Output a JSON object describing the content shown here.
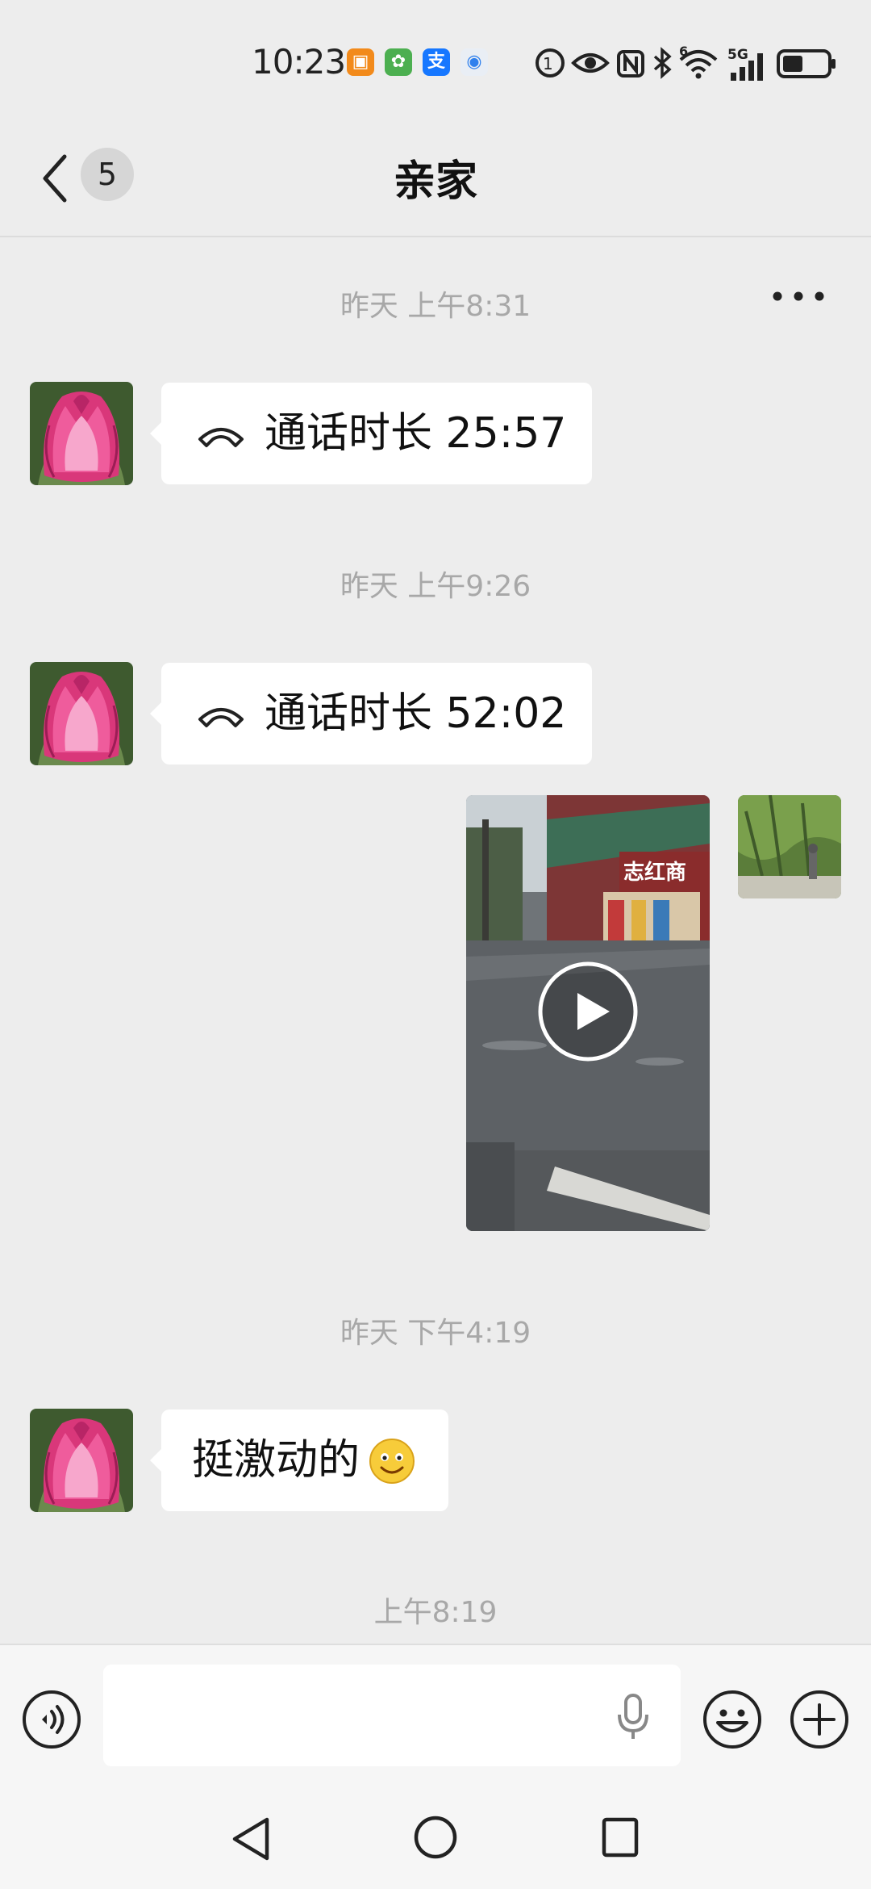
{
  "status_bar": {
    "time": "10:23",
    "app_icons": [
      "shop-icon",
      "flower-app-icon",
      "alipay-icon",
      "browser-icon"
    ],
    "system_icons": [
      "hd-call-icon",
      "eye-icon",
      "nfc-icon",
      "bluetooth-icon",
      "wifi-icon",
      "signal-5g-icon",
      "battery-icon"
    ],
    "wifi_badge": "6",
    "network": "5G"
  },
  "header": {
    "unread_count": "5",
    "title": "亲家"
  },
  "messages": [
    {
      "type": "timestamp",
      "text": "昨天 上午8:31"
    },
    {
      "type": "call",
      "from": "contact",
      "text": "通话时长 25:57"
    },
    {
      "type": "timestamp",
      "text": "昨天 上午9:26"
    },
    {
      "type": "call",
      "from": "contact",
      "text": "通话时长 52:02"
    },
    {
      "type": "video",
      "from": "self"
    },
    {
      "type": "timestamp",
      "text": "昨天 下午4:19"
    },
    {
      "type": "text",
      "from": "contact",
      "text": "挺激动的",
      "emoji": "smiley-emoji"
    },
    {
      "type": "timestamp",
      "text": "上午8:19"
    }
  ],
  "video_overlay_text": "志红商",
  "colors": {
    "background": "#ededed",
    "bubble": "#ffffff",
    "timestamp": "#a8a8a8",
    "input_bar": "#f6f6f6"
  }
}
